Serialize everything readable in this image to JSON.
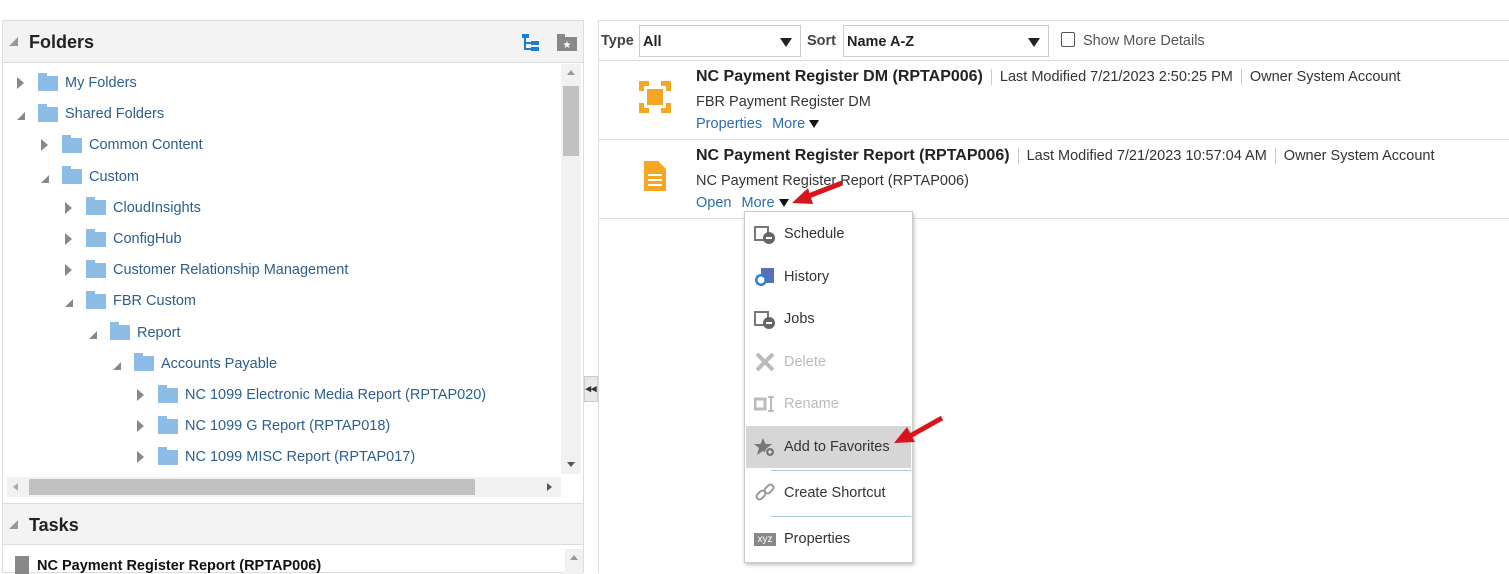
{
  "folders_panel": {
    "title": "Folders",
    "tree": [
      {
        "label": "My Folders",
        "level": 0,
        "expanded": false
      },
      {
        "label": "Shared Folders",
        "level": 0,
        "expanded": true
      },
      {
        "label": "Common Content",
        "level": 1,
        "expanded": false
      },
      {
        "label": "Custom",
        "level": 1,
        "expanded": true
      },
      {
        "label": "CloudInsights",
        "level": 2,
        "expanded": false
      },
      {
        "label": "ConfigHub",
        "level": 2,
        "expanded": false
      },
      {
        "label": "Customer Relationship Management",
        "level": 2,
        "expanded": false
      },
      {
        "label": "FBR Custom",
        "level": 2,
        "expanded": true
      },
      {
        "label": "Report",
        "level": 3,
        "expanded": true
      },
      {
        "label": "Accounts Payable",
        "level": 4,
        "expanded": true
      },
      {
        "label": "NC 1099 Electronic Media Report (RPTAP020)",
        "level": 5,
        "expanded": false
      },
      {
        "label": "NC 1099 G Report (RPTAP018)",
        "level": 5,
        "expanded": false
      },
      {
        "label": "NC 1099 MISC Report (RPTAP017)",
        "level": 5,
        "expanded": false
      }
    ]
  },
  "tasks_panel": {
    "title": "Tasks",
    "item": "NC Payment Register Report (RPTAP006)"
  },
  "toolbar": {
    "type_label": "Type",
    "type_value": "All",
    "sort_label": "Sort",
    "sort_value": "Name A-Z",
    "show_more_details": "Show More Details",
    "show_more_checked": false
  },
  "items": [
    {
      "title": "NC Payment Register DM (RPTAP006)",
      "modified": "Last Modified 7/21/2023 2:50:25 PM",
      "owner": "Owner System Account",
      "desc": "FBR Payment Register DM",
      "links": [
        "Properties",
        "More"
      ]
    },
    {
      "title": "NC Payment Register Report (RPTAP006)",
      "modified": "Last Modified 7/21/2023 10:57:04 AM",
      "owner": "Owner System Account",
      "desc": "NC Payment Register Report (RPTAP006)",
      "links": [
        "Open",
        "More"
      ]
    }
  ],
  "menu": [
    {
      "label": "Schedule",
      "icon": "schedule-icon",
      "disabled": false
    },
    {
      "label": "History",
      "icon": "history-icon",
      "disabled": false
    },
    {
      "label": "Jobs",
      "icon": "jobs-icon",
      "disabled": false
    },
    {
      "label": "Delete",
      "icon": "delete-icon",
      "disabled": true
    },
    {
      "label": "Rename",
      "icon": "rename-icon",
      "disabled": true
    },
    {
      "label": "Add to Favorites",
      "icon": "add-favorite-icon",
      "disabled": false,
      "highlighted": true
    },
    {
      "label": "Create Shortcut",
      "icon": "link-icon",
      "disabled": false
    },
    {
      "label": "Properties",
      "icon": "properties-icon",
      "disabled": false,
      "icon_text": "xyz"
    }
  ],
  "colors": {
    "link": "#2c6fb0",
    "folder": "#8dbde6",
    "accent_orange": "#f5a623",
    "arrow": "#d9141b"
  }
}
